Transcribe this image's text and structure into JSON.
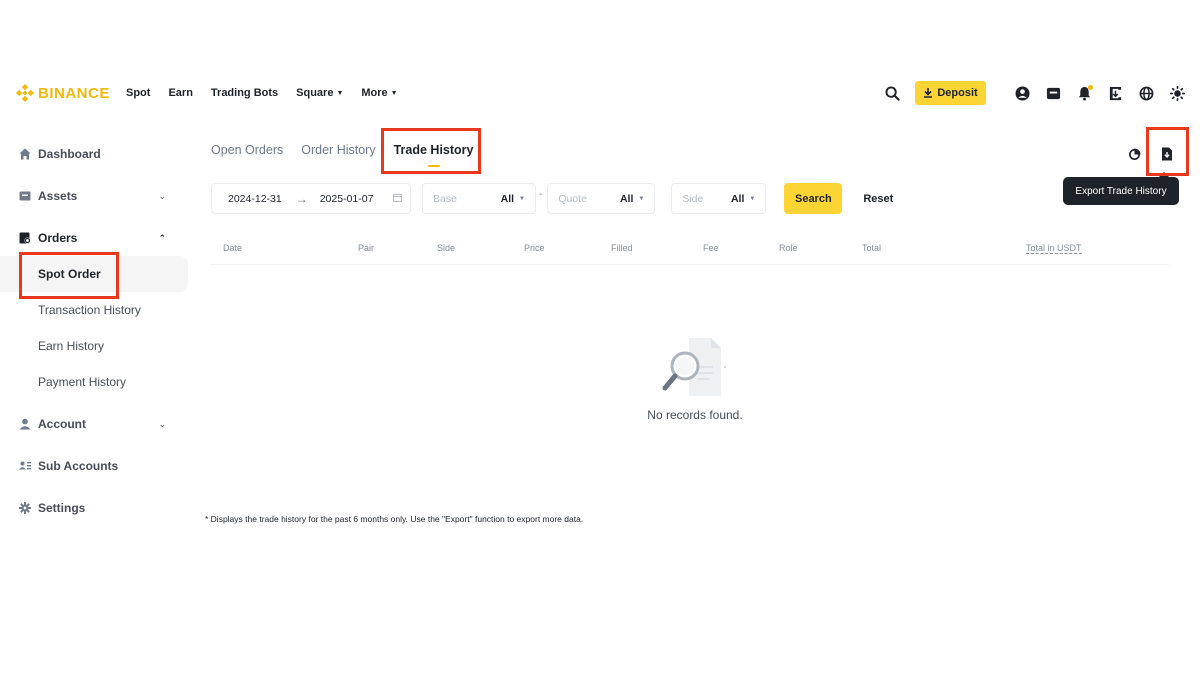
{
  "brand": {
    "name": "BINANCE",
    "color": "#f0b90b"
  },
  "nav": {
    "links": [
      {
        "label": "Spot",
        "has_menu": false
      },
      {
        "label": "Earn",
        "has_menu": false
      },
      {
        "label": "Trading Bots",
        "has_menu": false
      },
      {
        "label": "Square",
        "has_menu": true
      },
      {
        "label": "More",
        "has_menu": true
      }
    ],
    "deposit_label": "Deposit",
    "icons": [
      "search-icon",
      "user-icon",
      "wallet-icon",
      "bell-icon",
      "download-icon",
      "globe-icon",
      "theme-icon"
    ]
  },
  "sidebar": {
    "dashboard": "Dashboard",
    "assets": "Assets",
    "orders": "Orders",
    "orders_sub": [
      "Spot Order",
      "Transaction History",
      "Earn History",
      "Payment History"
    ],
    "account": "Account",
    "sub_accounts": "Sub Accounts",
    "settings": "Settings"
  },
  "tabs": [
    "Open Orders",
    "Order History",
    "Trade History"
  ],
  "active_tab": "Trade History",
  "filters": {
    "date_start": "2024-12-31",
    "date_end": "2025-01-07",
    "base_placeholder": "Base",
    "base_value": "All",
    "quote_placeholder": "Quote",
    "quote_value": "All",
    "side_placeholder": "Side",
    "side_value": "All",
    "search_label": "Search",
    "reset_label": "Reset"
  },
  "table": {
    "columns": [
      "Date",
      "Pair",
      "Side",
      "Price",
      "Filled",
      "Fee",
      "Role",
      "Total",
      "Total in USDT"
    ]
  },
  "empty_text": "No records found.",
  "footnote": "* Displays the trade history for the past 6 months only. Use the \"Export\" function to export more data.",
  "tooltip": "Export Trade History",
  "colors": {
    "accent": "#fcd535",
    "highlight": "#e8391c",
    "tooltip_bg": "#1e2329"
  }
}
